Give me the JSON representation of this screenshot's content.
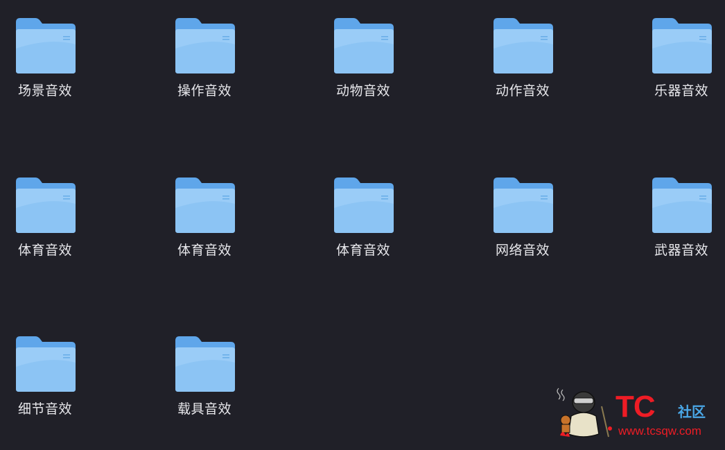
{
  "folders": [
    {
      "label": "场景音效"
    },
    {
      "label": "操作音效"
    },
    {
      "label": "动物音效"
    },
    {
      "label": "动作音效"
    },
    {
      "label": "乐器音效"
    },
    {
      "label": "体育音效"
    },
    {
      "label": "体育音效"
    },
    {
      "label": "体育音效"
    },
    {
      "label": "网络音效"
    },
    {
      "label": "武器音效"
    },
    {
      "label": "细节音效"
    },
    {
      "label": "载具音效"
    }
  ],
  "watermark": {
    "logo_text": "TC",
    "logo_suffix": "社区",
    "url": "www.tcsqw.com"
  },
  "colors": {
    "background": "#202028",
    "folder_front": "#8cc4f4",
    "folder_back": "#5fa6ea",
    "label_text": "#e8e8ec",
    "watermark_red": "#ee1c25",
    "watermark_blue": "#4aa8e8"
  },
  "icons": {
    "folder": "folder-icon",
    "watermark_mascot": "mascot-icon"
  }
}
